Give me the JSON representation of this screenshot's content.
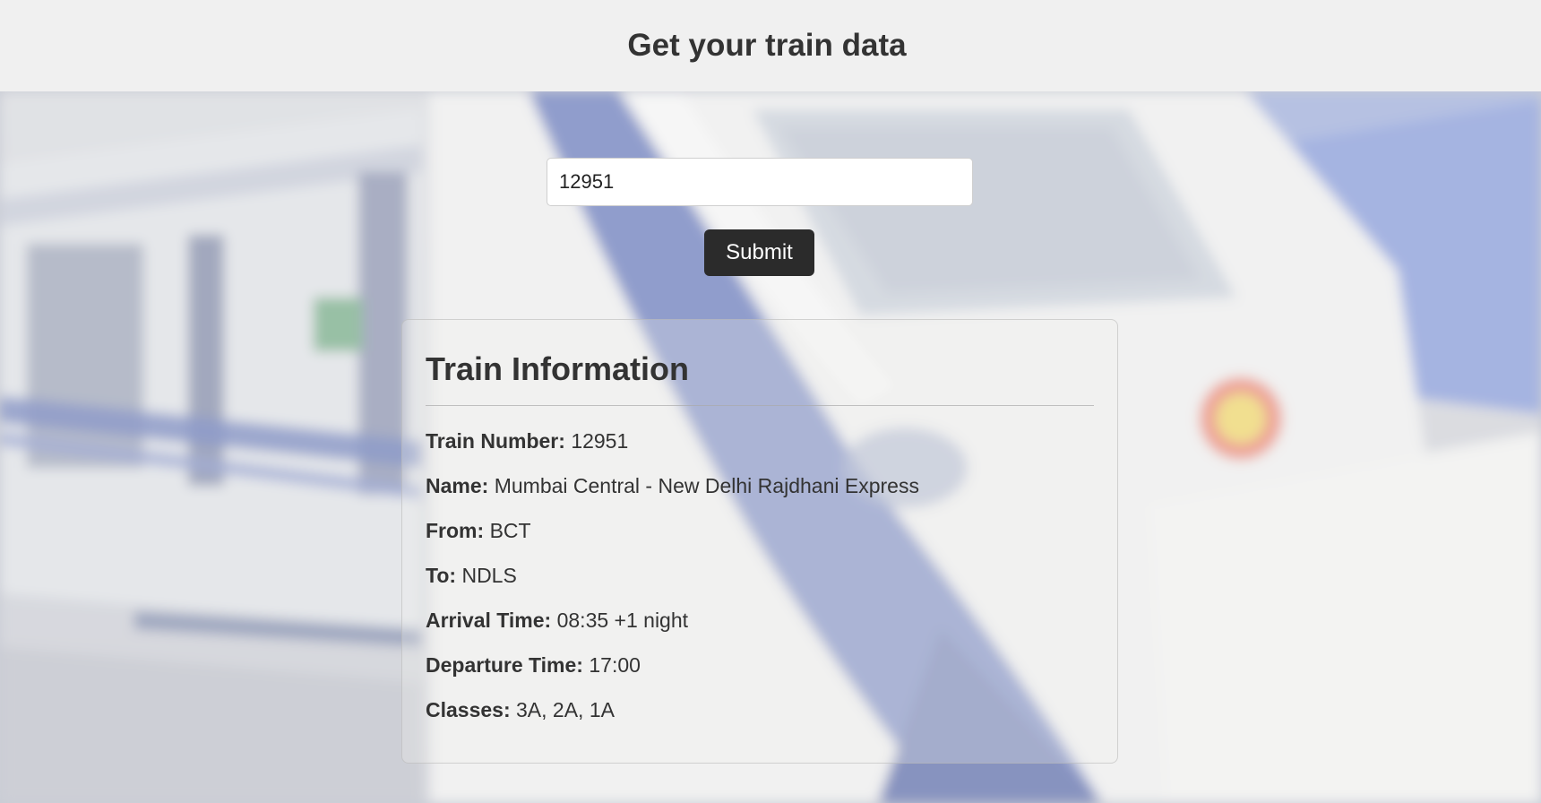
{
  "page": {
    "title": "Get your train data"
  },
  "search": {
    "value": "12951",
    "placeholder": "",
    "submit_label": "Submit"
  },
  "train_info": {
    "heading": "Train Information",
    "fields": [
      {
        "label": "Train Number:",
        "value": "12951"
      },
      {
        "label": "Name:",
        "value": "Mumbai Central - New Delhi Rajdhani Express"
      },
      {
        "label": "From:",
        "value": "BCT"
      },
      {
        "label": "To:",
        "value": "NDLS"
      },
      {
        "label": "Arrival Time:",
        "value": "08:35 +1 night"
      },
      {
        "label": "Departure Time:",
        "value": "17:00"
      },
      {
        "label": "Classes:",
        "value": "3A, 2A, 1A"
      }
    ]
  },
  "colors": {
    "header_bg": "#f0f0f0",
    "button_bg": "#2b2b2b",
    "train_blue": "#4a5fa8",
    "text": "#333333"
  }
}
